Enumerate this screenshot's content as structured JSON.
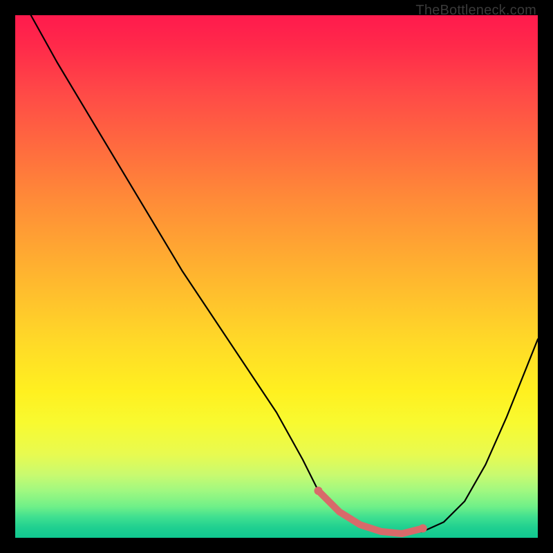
{
  "watermark": "TheBottleneck.com",
  "chart_data": {
    "type": "line",
    "title": "",
    "xlabel": "",
    "ylabel": "",
    "xlim": [
      0,
      100
    ],
    "ylim": [
      0,
      100
    ],
    "series": [
      {
        "name": "curve",
        "x": [
          3,
          8,
          14,
          20,
          26,
          32,
          38,
          44,
          50,
          55,
          58,
          62,
          66,
          70,
          74,
          78,
          82,
          86,
          90,
          94,
          98,
          100
        ],
        "y": [
          100,
          91,
          81,
          71,
          61,
          51,
          42,
          33,
          24,
          15,
          9,
          5,
          2.5,
          1.2,
          0.8,
          1.2,
          3,
          7,
          14,
          23,
          33,
          38
        ],
        "color": "#000000"
      },
      {
        "name": "highlight",
        "x": [
          58,
          62,
          66,
          70,
          74,
          78
        ],
        "y": [
          9,
          5,
          2.5,
          1.2,
          0.8,
          1.8
        ],
        "color": "#d86a6a"
      }
    ],
    "annotations": [],
    "legend": false,
    "grid": false
  },
  "colors": {
    "gradient_top": "#ff1a4d",
    "gradient_mid": "#ffd828",
    "gradient_bottom": "#10c890",
    "curve": "#000000",
    "highlight": "#d86a6a",
    "frame": "#000000"
  }
}
